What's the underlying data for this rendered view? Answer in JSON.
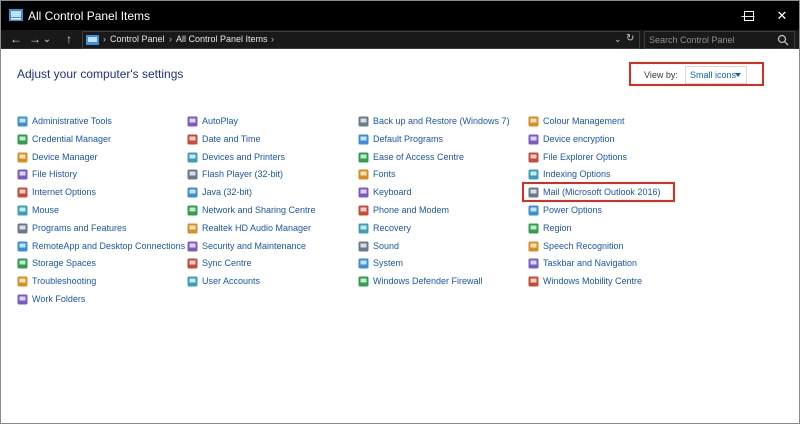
{
  "window": {
    "title": "All Control Panel Items",
    "controls": {
      "minimize": "—",
      "maximize": "☐",
      "close": "✕"
    }
  },
  "nav": {
    "back": "←",
    "forward": "→",
    "recent": "⌄",
    "up": "↑"
  },
  "address": {
    "crumbs": [
      "Control Panel",
      "All Control Panel Items"
    ],
    "separator": "›",
    "dropdown": "⌄",
    "refresh": "↻"
  },
  "search": {
    "placeholder": "Search Control Panel"
  },
  "main": {
    "heading": "Adjust your computer's settings",
    "view_by": {
      "label": "View by:",
      "value": "Small icons"
    }
  },
  "items": [
    [
      "Administrative Tools",
      "Credential Manager",
      "Device Manager",
      "File History",
      "Internet Options",
      "Mouse",
      "Programs and Features",
      "RemoteApp and Desktop Connections",
      "Storage Spaces",
      "Troubleshooting",
      "Work Folders"
    ],
    [
      "AutoPlay",
      "Date and Time",
      "Devices and Printers",
      "Flash Player (32-bit)",
      "Java (32-bit)",
      "Network and Sharing Centre",
      "Realtek HD Audio Manager",
      "Security and Maintenance",
      "Sync Centre",
      "User Accounts"
    ],
    [
      "Back up and Restore (Windows 7)",
      "Default Programs",
      "Ease of Access Centre",
      "Fonts",
      "Keyboard",
      "Phone and Modem",
      "Recovery",
      "Sound",
      "System",
      "Windows Defender Firewall"
    ],
    [
      "Colour Management",
      "Device encryption",
      "File Explorer Options",
      "Indexing Options",
      "Mail (Microsoft Outlook 2016)",
      "Power Options",
      "Region",
      "Speech Recognition",
      "Taskbar and Navigation",
      "Windows Mobility Centre"
    ]
  ],
  "icons": [
    [
      "tools-icon",
      "vault-icon",
      "device-manager-icon",
      "file-history-icon",
      "globe-icon",
      "mouse-icon",
      "programs-icon",
      "remote-desktop-icon",
      "storage-icon",
      "troubleshoot-icon",
      "folder-icon"
    ],
    [
      "autoplay-icon",
      "clock-icon",
      "printer-icon",
      "flash-icon",
      "java-icon",
      "network-icon",
      "speaker-icon",
      "flag-icon",
      "sync-icon",
      "users-icon"
    ],
    [
      "backup-icon",
      "check-icon",
      "accessibility-icon",
      "fonts-icon",
      "keyboard-icon",
      "phone-icon",
      "recovery-icon",
      "speaker-icon",
      "monitor-icon",
      "firewall-icon"
    ],
    [
      "color-icon",
      "lock-icon",
      "folder-icon",
      "search-icon",
      "mail-icon",
      "battery-icon",
      "globe-icon",
      "microphone-icon",
      "taskbar-icon",
      "laptop-icon"
    ]
  ],
  "colors": {
    "titlebar": "#000000",
    "link": "#1a56b0",
    "heading": "#1e3287",
    "annotation": "#e22a1c"
  }
}
